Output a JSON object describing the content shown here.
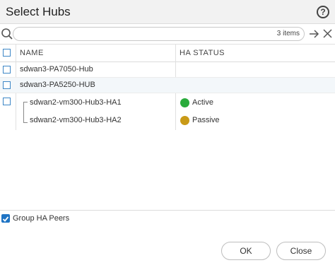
{
  "dialog": {
    "title": "Select Hubs",
    "help_icon": "question-circle-icon"
  },
  "search": {
    "value": "",
    "placeholder": "",
    "count": "3 items"
  },
  "table": {
    "columns": [
      "NAME",
      "HA STATUS"
    ],
    "rows": [
      {
        "name": "sdwan3-PA7050-Hub",
        "status": ""
      },
      {
        "name": "sdwan3-PA5250-HUB",
        "status": ""
      },
      {
        "name": "sdwan2-vm300-Hub3-HA1",
        "status": "Active",
        "status_color": "#2aab3c"
      },
      {
        "name": "sdwan2-vm300-Hub3-HA2",
        "status": "Passive",
        "status_color": "#c99a17"
      }
    ]
  },
  "group_ha_peers": {
    "label": "Group HA Peers",
    "checked": true
  },
  "buttons": {
    "ok": "OK",
    "close": "Close"
  },
  "colors": {
    "accent": "#1f74c4",
    "active": "#2aab3c",
    "passive": "#c99a17"
  }
}
